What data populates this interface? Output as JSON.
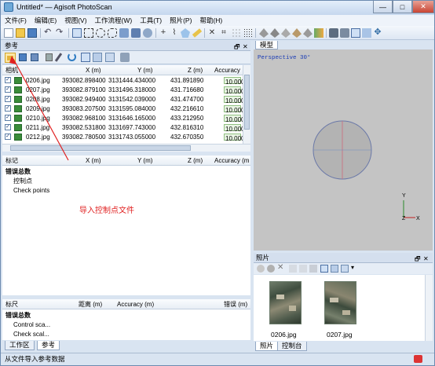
{
  "window": {
    "title": "Untitled* — Agisoft PhotoScan",
    "minimize_glyph": "—",
    "maximize_glyph": "□",
    "close_glyph": "✕"
  },
  "menu": [
    "文件(F)",
    "编辑(E)",
    "视图(V)",
    "工作流程(W)",
    "工具(T)",
    "照片(P)",
    "帮助(H)"
  ],
  "reference_panel": {
    "title": "参考",
    "float_glyph": "🗗",
    "close_glyph": "✕",
    "cameras": {
      "headers": [
        "相机",
        "X (m)",
        "Y (m)",
        "Z (m)",
        "Accuracy"
      ],
      "rows": [
        {
          "name": "0206.jpg",
          "x": "393082.898400",
          "y": "3131444.434000",
          "z": "431.891890",
          "acc": "10.000"
        },
        {
          "name": "0207.jpg",
          "x": "393082.879100",
          "y": "3131496.318000",
          "z": "431.716680",
          "acc": "10.000"
        },
        {
          "name": "0208.jpg",
          "x": "393082.949400",
          "y": "3131542.039000",
          "z": "431.474700",
          "acc": "10.000"
        },
        {
          "name": "0209.jpg",
          "x": "393083.207500",
          "y": "3131595.084000",
          "z": "432.216610",
          "acc": "10.000"
        },
        {
          "name": "0210.jpg",
          "x": "393082.968100",
          "y": "3131646.165000",
          "z": "433.212950",
          "acc": "10.000"
        },
        {
          "name": "0211.jpg",
          "x": "393082.531800",
          "y": "3131697.743000",
          "z": "432.816310",
          "acc": "10.000"
        },
        {
          "name": "0212.jpg",
          "x": "393082.780500",
          "y": "3131743.055000",
          "z": "432.670350",
          "acc": "10.000"
        }
      ]
    },
    "markers": {
      "headers": [
        "标记",
        "X (m)",
        "Y (m)",
        "Z (m)",
        "Accuracy (m"
      ],
      "group": "错误总数",
      "items": [
        "控制点",
        "Check points"
      ]
    },
    "scalebars": {
      "headers": [
        "标尺",
        "距离 (m)",
        "Accuracy (m)",
        "错误 (m)"
      ],
      "group": "错误总数",
      "items": [
        "Control sca...",
        "Check scal..."
      ]
    },
    "annotation": "导入控制点文件"
  },
  "left_tabs": [
    "工作区",
    "参考"
  ],
  "model_panel": {
    "tab": "模型",
    "projection": "Perspective 30°",
    "axis_y": "Y",
    "axis_x": "X",
    "axis_z": "Z"
  },
  "photos_panel": {
    "title": "照片",
    "thumbs": [
      "0206.jpg",
      "0207.jpg"
    ],
    "tabs": [
      "照片",
      "控制台"
    ]
  },
  "status": "从文件导入参考数据",
  "colors": {
    "titlebar": "#c5d7ee",
    "panel_bg": "#d9e4f1",
    "annotation_red": "#e02020",
    "sphere": "#b3b3b3"
  }
}
